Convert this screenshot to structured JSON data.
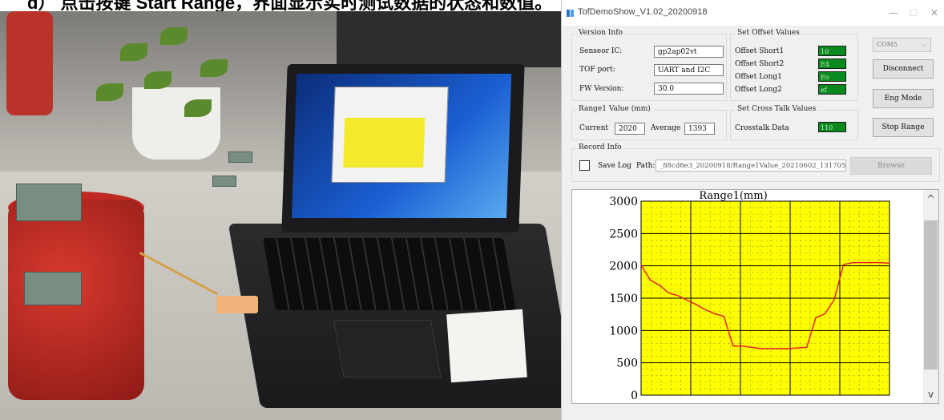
{
  "caption": {
    "text": "d） 点击按键 Start Range，界面显示实时测试数据的状态和数值。"
  },
  "app": {
    "title": "TofDemoShow_V1.02_20200918",
    "window_controls": {
      "minimize": "—",
      "maximize": "☐",
      "close": "✕"
    },
    "version_info": {
      "title": "Version Info",
      "sensor_ic_label": "Senseor IC:",
      "sensor_ic_value": "gp2ap02vt",
      "tof_port_label": "TOF port:",
      "tof_port_value": "UART and I2C",
      "fw_version_label": "FW Version:",
      "fw_version_value": "30.0"
    },
    "offset": {
      "title": "Set Offset Values",
      "short1_label": "Offset Short1",
      "short1_value": "10",
      "short2_label": "Offset Short2",
      "short2_value": "E4",
      "long1_label": "Offset Long1",
      "long1_value": "Eo",
      "long2_label": "Offset Long2",
      "long2_value": "ef"
    },
    "range1": {
      "title": "Range1 Value (mm)",
      "current_label": "Current",
      "current_value": "2020",
      "average_label": "Average",
      "average_value": "1393"
    },
    "crosstalk": {
      "title": "Set Cross Talk Values",
      "label": "Crosstalk Data",
      "value": "110"
    },
    "buttons": {
      "com_port": "COM5",
      "disconnect": "Disconnect",
      "eng_mode": "Eng Mode",
      "stop_range": "Stop Range",
      "browse": "Browse"
    },
    "record_info": {
      "title": "Record Info",
      "save_log_label": "Save Log",
      "path_label": "Path:",
      "path_value": "_88cd8e3_20200918/Range1Value_20210602_131705.log"
    },
    "scroll": {
      "up": "^",
      "down": "v"
    }
  },
  "colors": {
    "plot_background": "#ffff00",
    "line": "#e8202a",
    "value_box": "#0a8a1e"
  },
  "chart_data": {
    "type": "line",
    "title": "Range1(mm)",
    "ylim": [
      0,
      3000
    ],
    "yticks": [
      "3000",
      "2500",
      "2000",
      "1500",
      "1000",
      "500",
      "0"
    ],
    "ytick_values": [
      3000,
      2500,
      2000,
      1500,
      1000,
      500,
      0
    ],
    "grid": true,
    "series": [
      {
        "values": [
          2010,
          1780,
          1700,
          1580,
          1540,
          1470,
          1400,
          1320,
          1260,
          1220,
          760,
          760,
          740,
          720,
          720,
          720,
          720,
          730,
          740,
          1200,
          1260,
          1480,
          2020,
          2050,
          2050,
          2050,
          2050,
          2040
        ]
      }
    ]
  }
}
